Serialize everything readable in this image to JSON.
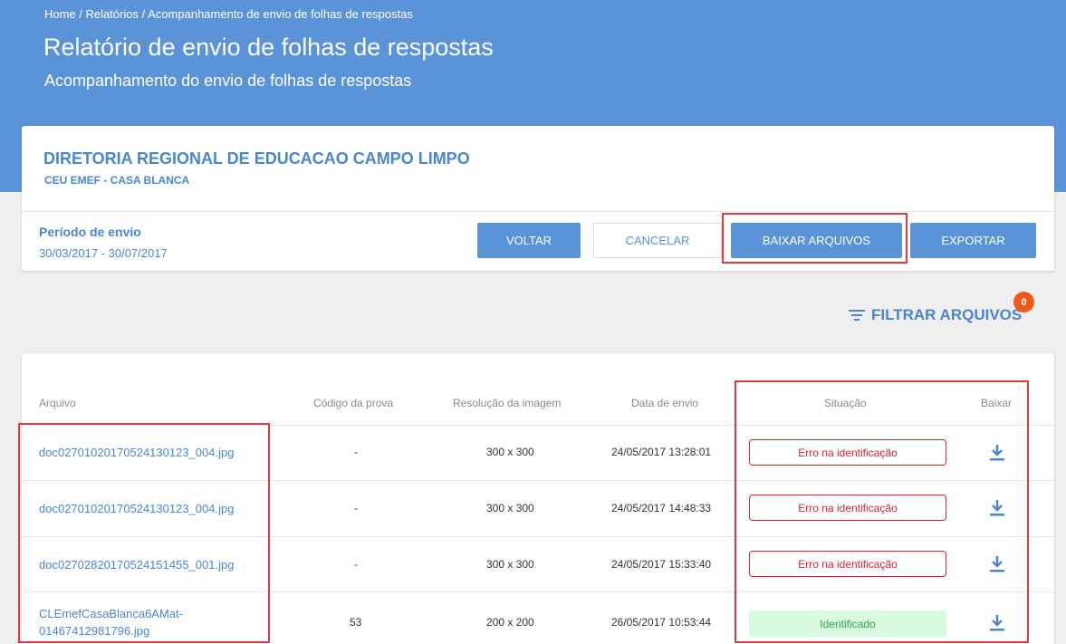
{
  "header": {
    "breadcrumb": "Home / Relatórios / Acompanhamento de envio de folhas de respostas",
    "title": "Relatório de envio de folhas de respostas",
    "subtitle": "Acompanhamento do envio de folhas de respostas"
  },
  "info": {
    "dre": "DIRETORIA REGIONAL DE EDUCACAO CAMPO LIMPO",
    "school": "CEU EMEF - CASA BLANCA",
    "period_label": "Período de envio",
    "period_value": "30/03/2017 - 30/07/2017"
  },
  "actions": {
    "voltar": "VOLTAR",
    "cancelar": "CANCELAR",
    "baixar": "BAIXAR ARQUIVOS",
    "exportar": "EXPORTAR"
  },
  "filter": {
    "label": "FILTRAR ARQUIVOS",
    "count": "0",
    "icon": "filter-list-icon"
  },
  "table": {
    "headers": {
      "arquivo": "Arquivo",
      "codigo": "Código da prova",
      "resolucao": "Resolução da imagem",
      "data": "Data de envio",
      "situacao": "Situação",
      "baixar": "Baixar"
    },
    "rows": [
      {
        "arquivo": "doc02701020170524130123_004.jpg",
        "codigo": "-",
        "resolucao": "300 x 300",
        "data": "24/05/2017 13:28:01",
        "situacao": "Erro na identificação"
      },
      {
        "arquivo": "doc02701020170524130123_004.jpg",
        "codigo": "-",
        "resolucao": "300 x 300",
        "data": "24/05/2017 14:48:33",
        "situacao": "Erro na identificação"
      },
      {
        "arquivo": "doc02702820170524151455_001.jpg",
        "codigo": "-",
        "resolucao": "300 x 300",
        "data": "24/05/2017 15:33:40",
        "situacao": "Erro na identificação"
      },
      {
        "arquivo_line1": "CLEmefCasaBlanca6AMat-",
        "arquivo_line2": "01467412981796.jpg",
        "codigo": "53",
        "resolucao": "200 x 200",
        "data": "26/05/2017 10:53:44",
        "situacao": "Identificado"
      }
    ]
  },
  "colors": {
    "header_bg": "#5b93d8",
    "accent": "#4a86cf",
    "error": "#d9232b",
    "success_bg": "#d7fadf",
    "success_text": "#2ea44f",
    "badge": "#f05a19",
    "highlight": "#e03a3a"
  }
}
